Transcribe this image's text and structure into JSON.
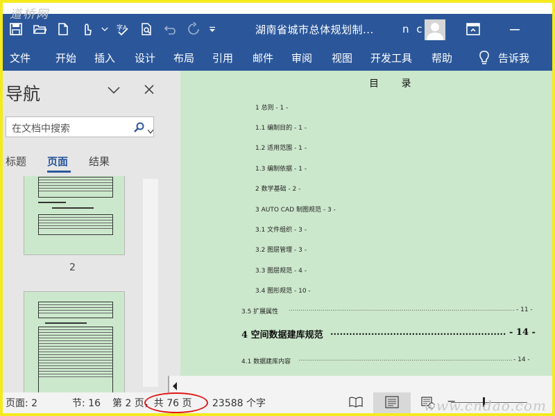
{
  "watermarks": {
    "top": "道桥网",
    "bottom": "www.cndao.com"
  },
  "titlebar": {
    "document_title": "湖南省城市总体规划制...",
    "user": "n c",
    "icons": [
      "save-icon",
      "open-icon",
      "new-document-icon",
      "touch-mode-icon",
      "dropdown-icon",
      "spelling-icon",
      "print-preview-icon",
      "undo-icon",
      "redo-icon",
      "customize-qat-icon",
      "ribbon-display-icon"
    ]
  },
  "ribbon": {
    "tabs": [
      "文件",
      "开始",
      "插入",
      "设计",
      "布局",
      "引用",
      "邮件",
      "审阅",
      "视图",
      "开发工具",
      "帮助"
    ],
    "tell_me": "告诉我"
  },
  "navigation": {
    "title": "导航",
    "search_placeholder": "在文档中搜索",
    "tabs": [
      "标题",
      "页面",
      "结果"
    ],
    "active_tab": "页面",
    "thumbnail_labels": [
      "2"
    ]
  },
  "document": {
    "toc_title": "目 录",
    "toc_entries": [
      "1 总则  - 1 -",
      "1.1 编制目的 - 1 -",
      "1.2 适用范围 - 1 -",
      "1.3 编制依据 - 1 -",
      "2 数学基础  - 2 -",
      "3 AUTO CAD 制图规范  - 3 -",
      "3.1 文件组织 - 3 -",
      "3.2 图层管理 - 3 -",
      "3.3 图层规范 - 4 -",
      "3.4 图形规范 - 10 -"
    ],
    "toc_dotted": [
      {
        "label": "3.5 扩展属性",
        "page": "- 11 -"
      },
      {
        "label": "4 空间数据建库规范",
        "page": "- 14 -"
      },
      {
        "label": "4.1 数据建库内容",
        "page": "- 14 -"
      }
    ]
  },
  "statusbar": {
    "page": "页面: 2",
    "section": "节: 16",
    "page_of": "第 2 页，共 76 页",
    "words": "23588 个字"
  },
  "colors": {
    "accent": "#2b579a",
    "page_bg": "#cce8cc",
    "frame": "#f5ea1e",
    "highlight": "#e01818"
  }
}
